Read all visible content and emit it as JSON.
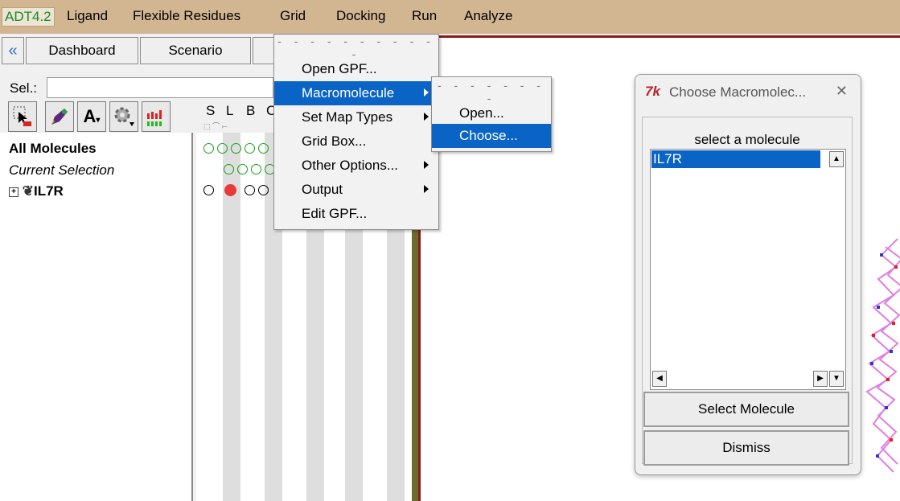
{
  "menubar": {
    "items": [
      "ADT4.2",
      "Ligand",
      "Flexible Residues",
      "Grid",
      "Docking",
      "Run",
      "Analyze"
    ]
  },
  "toolbar": {
    "back_icon": "double-chevron-left-icon",
    "tabs": [
      "Dashboard",
      "Scenario"
    ]
  },
  "selection": {
    "label": "Sel.:",
    "value": ""
  },
  "tree": {
    "all_molecules": "All Molecules",
    "current_selection": "Current Selection",
    "molecule": "IL7R"
  },
  "columns": {
    "headers": [
      "S",
      "L",
      "B",
      "C"
    ]
  },
  "grid_menu": {
    "tearoff": "- - - - - - - - - - -",
    "items": [
      "Open GPF...",
      "Macromolecule",
      "Set Map Types",
      "Grid Box...",
      "Other Options...",
      "Output",
      "Edit GPF..."
    ]
  },
  "macromolecule_submenu": {
    "tearoff": "- - - - - - - -",
    "items": [
      "Open...",
      "Choose..."
    ]
  },
  "dialog": {
    "title": "Choose Macromolec...",
    "close": "✕",
    "group_label": "select a molecule",
    "list_items": [
      "IL7R"
    ],
    "select_button": "Select Molecule",
    "dismiss_button": "Dismiss"
  },
  "colors": {
    "menubar": "#d2b692",
    "highlight": "#0a64c6",
    "viewer_border": "#8b1a1a",
    "green_circle": "#1aa01a",
    "red_circle": "#e83a3a"
  }
}
